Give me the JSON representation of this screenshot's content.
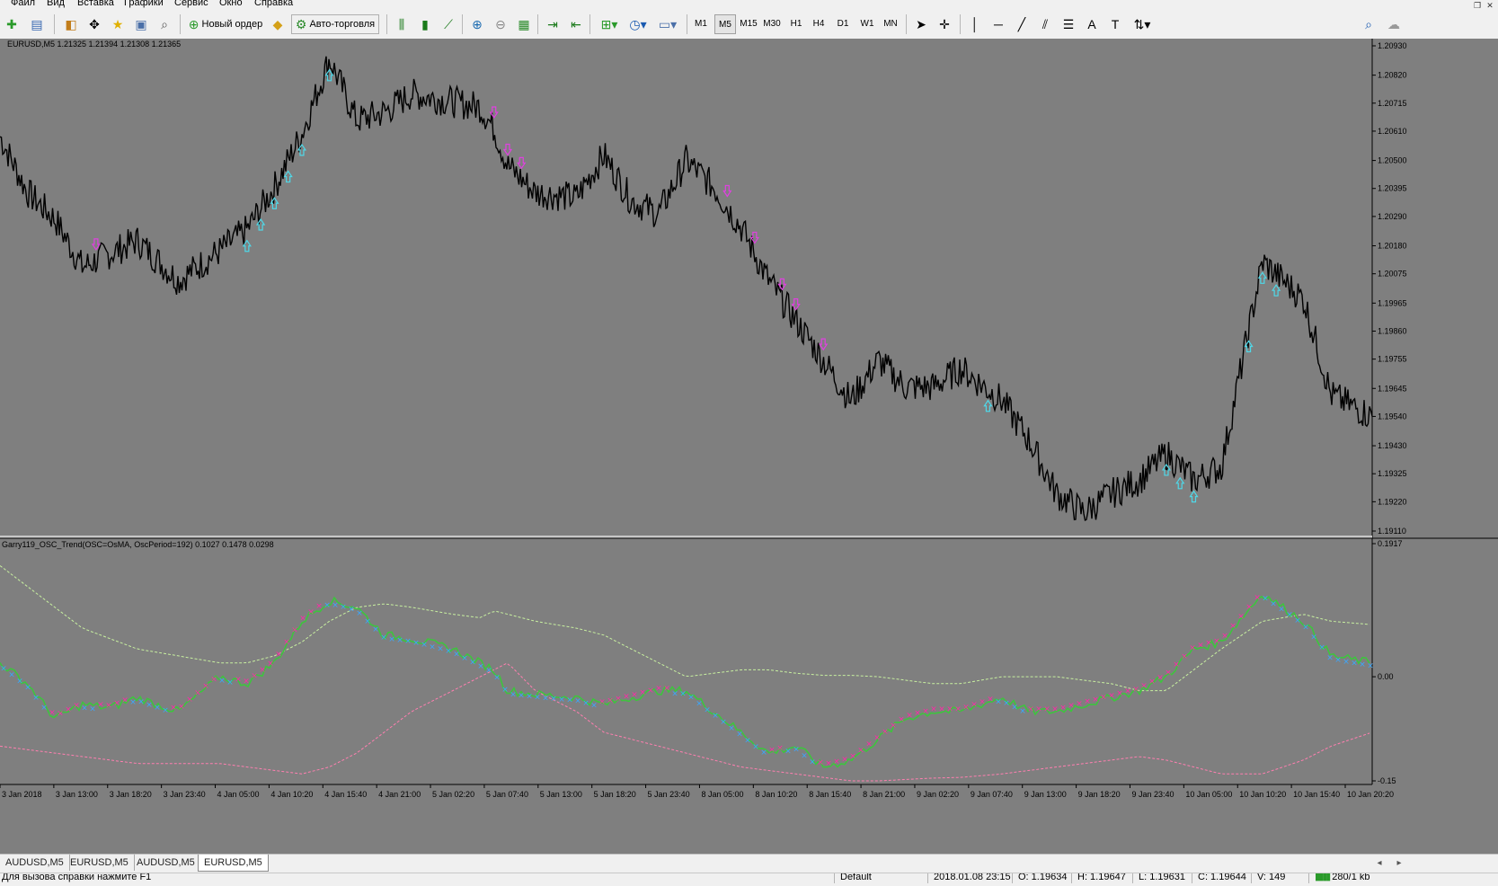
{
  "menu": [
    "Файл",
    "Вид",
    "Вставка",
    "Графики",
    "Сервис",
    "Окно",
    "Справка"
  ],
  "toolbar": {
    "new_order_label": "Новый ордер",
    "autotrading_label": "Авто-торговля",
    "timeframes": [
      "M1",
      "M5",
      "M15",
      "M30",
      "H1",
      "H4",
      "D1",
      "W1",
      "MN"
    ],
    "active_timeframe": "M5"
  },
  "main_chart": {
    "header": "EURUSD,M5  1.21325 1.21394 1.21308 1.21365",
    "price_axis": [
      "1.20930",
      "1.20820",
      "1.20715",
      "1.20610",
      "1.20500",
      "1.20395",
      "1.20290",
      "1.20180",
      "1.20075",
      "1.19965",
      "1.19860",
      "1.19755",
      "1.19645",
      "1.19540",
      "1.19430",
      "1.19325",
      "1.19220",
      "1.19110"
    ],
    "price_range": [
      1.1911,
      1.2093
    ]
  },
  "indicator": {
    "header": "Garry119_OSC_Trend(OSC=OsMA, OscPeriod=192) 0.1027 0.1478 0.0298",
    "axis": [
      "0.1917",
      "0.00",
      "-0.15"
    ]
  },
  "time_axis": [
    "3 Jan 2018",
    "3 Jan 13:00",
    "3 Jan 18:20",
    "3 Jan 23:40",
    "4 Jan 05:00",
    "4 Jan 10:20",
    "4 Jan 15:40",
    "4 Jan 21:00",
    "5 Jan 02:20",
    "5 Jan 07:40",
    "5 Jan 13:00",
    "5 Jan 18:20",
    "5 Jan 23:40",
    "8 Jan 05:00",
    "8 Jan 10:20",
    "8 Jan 15:40",
    "8 Jan 21:00",
    "9 Jan 02:20",
    "9 Jan 07:40",
    "9 Jan 13:00",
    "9 Jan 18:20",
    "9 Jan 23:40",
    "10 Jan 05:00",
    "10 Jan 10:20",
    "10 Jan 15:40",
    "10 Jan 20:20"
  ],
  "tabs": [
    "AUDUSD,M5",
    "EURUSD,M5",
    "AUDUSD,M5",
    "EURUSD,M5"
  ],
  "active_tab": 3,
  "status": {
    "help": "Для вызова справки нажмите F1",
    "profile": "Default",
    "datetime": "2018.01.08 23:15",
    "open": "O: 1.19634",
    "high": "H: 1.19647",
    "low": "L: 1.19631",
    "close": "C: 1.19644",
    "volume": "V: 149",
    "traffic": "280/1 kb"
  },
  "colors": {
    "chart_bg": "#7f7f7f",
    "price_line": "#000000",
    "buy_arrow": "#4fd8e8",
    "sell_arrow": "#e040e0",
    "osc_line": "#3ec43e",
    "osc_up_marker": "#ff2aa8",
    "osc_down_marker": "#3aa8ff",
    "upper_band": "#c8f0a0",
    "lower_band": "#ff7fb0"
  },
  "chart_data": [
    {
      "type": "line",
      "title": "EURUSD,M5",
      "y_range": [
        1.1911,
        1.2093
      ],
      "x": [
        0,
        2,
        4,
        6,
        8,
        10,
        13,
        16,
        18,
        20,
        22,
        24,
        26,
        28,
        30,
        33,
        35,
        36,
        37,
        39,
        42,
        44,
        46,
        48,
        50,
        52,
        54,
        56,
        58,
        60,
        62,
        64,
        66,
        68,
        70,
        73,
        75,
        77,
        79,
        81,
        83,
        85,
        87,
        89,
        92,
        95,
        97,
        100
      ],
      "series": [
        {
          "values": [
            1.2059,
            1.2038,
            1.2028,
            1.201,
            1.2015,
            1.202,
            1.2005,
            1.2016,
            1.2024,
            1.204,
            1.206,
            1.2088,
            1.2065,
            1.2068,
            1.2075,
            1.2072,
            1.207,
            1.2062,
            1.2048,
            1.2038,
            1.2036,
            1.2052,
            1.2035,
            1.203,
            1.205,
            1.204,
            1.2025,
            1.2005,
            1.199,
            1.1975,
            1.196,
            1.1975,
            1.1965,
            1.1965,
            1.1972,
            1.196,
            1.1945,
            1.1925,
            1.1918,
            1.1925,
            1.193,
            1.194,
            1.193,
            1.1935,
            1.2012,
            1.1998,
            1.1962,
            1.1954
          ]
        }
      ],
      "buy_arrows_at": [
        18,
        19,
        20,
        21,
        22,
        24,
        72,
        85,
        86,
        87,
        91,
        92,
        93
      ],
      "sell_arrows_at": [
        7,
        36,
        37,
        38,
        53,
        55,
        57,
        58,
        60
      ]
    },
    {
      "type": "line",
      "title": "Garry119_OSC_Trend(OSC=OsMA, OscPeriod=192)",
      "y_range": [
        -0.15,
        0.1917
      ],
      "x": [
        0,
        2,
        4,
        6,
        8,
        10,
        13,
        16,
        18,
        20,
        22,
        24,
        26,
        28,
        30,
        33,
        35,
        36,
        37,
        39,
        42,
        44,
        46,
        48,
        50,
        52,
        54,
        56,
        58,
        60,
        62,
        64,
        66,
        68,
        70,
        73,
        75,
        77,
        79,
        81,
        83,
        85,
        87,
        89,
        92,
        95,
        97,
        100
      ],
      "series": [
        {
          "name": "osc",
          "values": [
            0.02,
            -0.01,
            -0.06,
            -0.04,
            -0.045,
            -0.03,
            -0.05,
            0.0,
            -0.01,
            0.02,
            0.08,
            0.11,
            0.1,
            0.06,
            0.055,
            0.04,
            0.02,
            0.01,
            -0.02,
            -0.025,
            -0.03,
            -0.04,
            -0.03,
            -0.02,
            -0.02,
            -0.05,
            -0.08,
            -0.11,
            -0.1,
            -0.13,
            -0.12,
            -0.09,
            -0.06,
            -0.05,
            -0.05,
            -0.03,
            -0.05,
            -0.05,
            -0.04,
            -0.03,
            -0.02,
            0.0,
            0.04,
            0.05,
            0.12,
            0.08,
            0.03,
            0.02
          ]
        },
        {
          "name": "upper",
          "values": [
            0.16,
            0.13,
            0.1,
            0.07,
            0.055,
            0.04,
            0.03,
            0.02,
            0.02,
            0.03,
            0.05,
            0.08,
            0.1,
            0.105,
            0.1,
            0.09,
            0.085,
            0.095,
            0.09,
            0.08,
            0.07,
            0.06,
            0.04,
            0.02,
            0.0,
            0.005,
            0.01,
            0.01,
            0.005,
            0.002,
            0.002,
            0.0,
            -0.005,
            -0.01,
            -0.01,
            0.0,
            0.0,
            0.0,
            -0.005,
            -0.01,
            -0.02,
            -0.02,
            0.01,
            0.04,
            0.08,
            0.09,
            0.08,
            0.075
          ]
        },
        {
          "name": "lower",
          "values": [
            -0.1,
            -0.105,
            -0.11,
            -0.115,
            -0.12,
            -0.125,
            -0.125,
            -0.125,
            -0.13,
            -0.135,
            -0.14,
            -0.13,
            -0.11,
            -0.08,
            -0.05,
            -0.02,
            0.0,
            0.01,
            0.02,
            -0.02,
            -0.05,
            -0.08,
            -0.09,
            -0.1,
            -0.11,
            -0.12,
            -0.13,
            -0.135,
            -0.14,
            -0.145,
            -0.15,
            -0.15,
            -0.148,
            -0.146,
            -0.145,
            -0.14,
            -0.135,
            -0.13,
            -0.125,
            -0.12,
            -0.115,
            -0.12,
            -0.13,
            -0.14,
            -0.14,
            -0.12,
            -0.1,
            -0.08
          ]
        }
      ]
    }
  ]
}
